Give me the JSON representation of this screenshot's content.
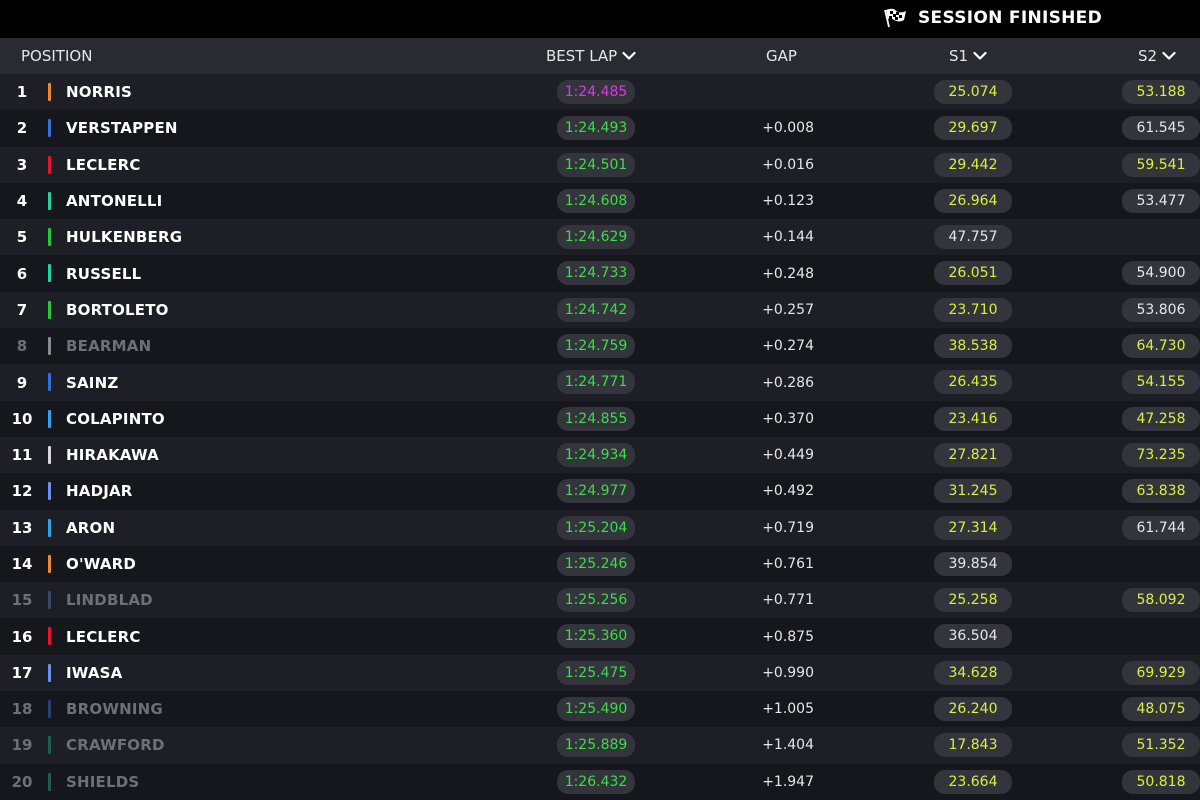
{
  "session": {
    "status": "SESSION FINISHED",
    "icon": "checkered-flag-icon"
  },
  "columns": {
    "position": "POSITION",
    "best_lap": "BEST LAP",
    "gap": "GAP",
    "s1": "S1",
    "s2": "S2"
  },
  "colors": {
    "fastest": "#d63de0",
    "personal_best": "#3cdc4a",
    "sector_yellow": "#d9f03c",
    "sector_white": "#e6e6e6"
  },
  "rows": [
    {
      "pos": "1",
      "name": "NORRIS",
      "team_color": "#f08a28",
      "best": "1:24.485",
      "best_fastest": true,
      "gap": "",
      "s1": "25.074",
      "s1_color": "yellow",
      "s2": "53.188",
      "s2_color": "yellow",
      "dim": false
    },
    {
      "pos": "2",
      "name": "VERSTAPPEN",
      "team_color": "#3a71d8",
      "best": "1:24.493",
      "best_fastest": false,
      "gap": "+0.008",
      "s1": "29.697",
      "s1_color": "yellow",
      "s2": "61.545",
      "s2_color": "white",
      "dim": false
    },
    {
      "pos": "3",
      "name": "LECLERC",
      "team_color": "#e8172d",
      "best": "1:24.501",
      "best_fastest": false,
      "gap": "+0.016",
      "s1": "29.442",
      "s1_color": "yellow",
      "s2": "59.541",
      "s2_color": "yellow",
      "dim": false
    },
    {
      "pos": "4",
      "name": "ANTONELLI",
      "team_color": "#22d3a5",
      "best": "1:24.608",
      "best_fastest": false,
      "gap": "+0.123",
      "s1": "26.964",
      "s1_color": "yellow",
      "s2": "53.477",
      "s2_color": "white",
      "dim": false
    },
    {
      "pos": "5",
      "name": "HULKENBERG",
      "team_color": "#27c93c",
      "best": "1:24.629",
      "best_fastest": false,
      "gap": "+0.144",
      "s1": "47.757",
      "s1_color": "white",
      "s2": "",
      "s2_color": "white",
      "dim": false
    },
    {
      "pos": "6",
      "name": "RUSSELL",
      "team_color": "#22d3a5",
      "best": "1:24.733",
      "best_fastest": false,
      "gap": "+0.248",
      "s1": "26.051",
      "s1_color": "yellow",
      "s2": "54.900",
      "s2_color": "white",
      "dim": false
    },
    {
      "pos": "7",
      "name": "BORTOLETO",
      "team_color": "#27c93c",
      "best": "1:24.742",
      "best_fastest": false,
      "gap": "+0.257",
      "s1": "23.710",
      "s1_color": "yellow",
      "s2": "53.806",
      "s2_color": "white",
      "dim": false
    },
    {
      "pos": "8",
      "name": "BEARMAN",
      "team_color": "#8a8a92",
      "best": "1:24.759",
      "best_fastest": false,
      "gap": "+0.274",
      "s1": "38.538",
      "s1_color": "yellow",
      "s2": "64.730",
      "s2_color": "yellow",
      "dim": true
    },
    {
      "pos": "9",
      "name": "SAINZ",
      "team_color": "#2c6fe0",
      "best": "1:24.771",
      "best_fastest": false,
      "gap": "+0.286",
      "s1": "26.435",
      "s1_color": "yellow",
      "s2": "54.155",
      "s2_color": "yellow",
      "dim": false
    },
    {
      "pos": "10",
      "name": "COLAPINTO",
      "team_color": "#2fa4e8",
      "best": "1:24.855",
      "best_fastest": false,
      "gap": "+0.370",
      "s1": "23.416",
      "s1_color": "yellow",
      "s2": "47.258",
      "s2_color": "yellow",
      "dim": false
    },
    {
      "pos": "11",
      "name": "HIRAKAWA",
      "team_color": "#d8d8dc",
      "best": "1:24.934",
      "best_fastest": false,
      "gap": "+0.449",
      "s1": "27.821",
      "s1_color": "yellow",
      "s2": "73.235",
      "s2_color": "yellow",
      "dim": false
    },
    {
      "pos": "12",
      "name": "HADJAR",
      "team_color": "#6c8ff0",
      "best": "1:24.977",
      "best_fastest": false,
      "gap": "+0.492",
      "s1": "31.245",
      "s1_color": "yellow",
      "s2": "63.838",
      "s2_color": "yellow",
      "dim": false
    },
    {
      "pos": "13",
      "name": "ARON",
      "team_color": "#2fa4e8",
      "best": "1:25.204",
      "best_fastest": false,
      "gap": "+0.719",
      "s1": "27.314",
      "s1_color": "yellow",
      "s2": "61.744",
      "s2_color": "white",
      "dim": false
    },
    {
      "pos": "14",
      "name": "O'WARD",
      "team_color": "#f08a28",
      "best": "1:25.246",
      "best_fastest": false,
      "gap": "+0.761",
      "s1": "39.854",
      "s1_color": "white",
      "s2": "",
      "s2_color": "white",
      "dim": false
    },
    {
      "pos": "15",
      "name": "LINDBLAD",
      "team_color": "#3a4a66",
      "best": "1:25.256",
      "best_fastest": false,
      "gap": "+0.771",
      "s1": "25.258",
      "s1_color": "yellow",
      "s2": "58.092",
      "s2_color": "yellow",
      "dim": true
    },
    {
      "pos": "16",
      "name": "LECLERC",
      "team_color": "#e8172d",
      "best": "1:25.360",
      "best_fastest": false,
      "gap": "+0.875",
      "s1": "36.504",
      "s1_color": "white",
      "s2": "",
      "s2_color": "white",
      "dim": false
    },
    {
      "pos": "17",
      "name": "IWASA",
      "team_color": "#6c8ff0",
      "best": "1:25.475",
      "best_fastest": false,
      "gap": "+0.990",
      "s1": "34.628",
      "s1_color": "yellow",
      "s2": "69.929",
      "s2_color": "yellow",
      "dim": false
    },
    {
      "pos": "18",
      "name": "BROWNING",
      "team_color": "#2a3f73",
      "best": "1:25.490",
      "best_fastest": false,
      "gap": "+1.005",
      "s1": "26.240",
      "s1_color": "yellow",
      "s2": "48.075",
      "s2_color": "yellow",
      "dim": true
    },
    {
      "pos": "19",
      "name": "CRAWFORD",
      "team_color": "#1f5e4e",
      "best": "1:25.889",
      "best_fastest": false,
      "gap": "+1.404",
      "s1": "17.843",
      "s1_color": "yellow",
      "s2": "51.352",
      "s2_color": "yellow",
      "dim": true
    },
    {
      "pos": "20",
      "name": "SHIELDS",
      "team_color": "#1f5e4e",
      "best": "1:26.432",
      "best_fastest": false,
      "gap": "+1.947",
      "s1": "23.664",
      "s1_color": "yellow",
      "s2": "50.818",
      "s2_color": "yellow",
      "dim": true
    }
  ]
}
